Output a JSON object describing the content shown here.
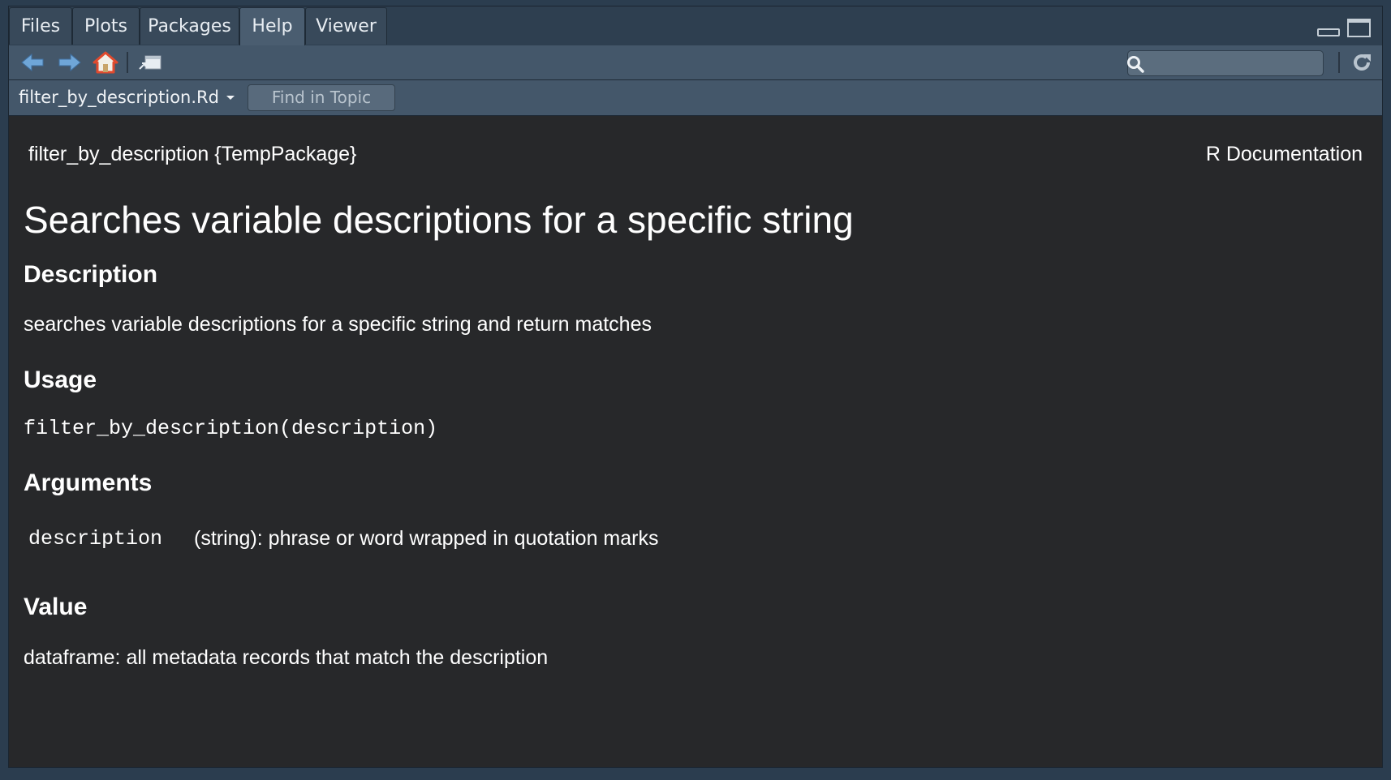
{
  "tabs": [
    {
      "label": "Files",
      "active": false
    },
    {
      "label": "Plots",
      "active": false
    },
    {
      "label": "Packages",
      "active": false
    },
    {
      "label": "Help",
      "active": true
    },
    {
      "label": "Viewer",
      "active": false
    }
  ],
  "toolbar": {
    "back_icon": "arrow-left-icon",
    "forward_icon": "arrow-right-icon",
    "home_icon": "home-icon",
    "popout_icon": "show-in-window-icon",
    "refresh_icon": "refresh-icon",
    "search_placeholder": ""
  },
  "topic_bar": {
    "topic": "filter_by_description.Rd",
    "find_label": "Find in Topic"
  },
  "doc": {
    "header_left": "filter_by_description {TempPackage}",
    "header_right": "R Documentation",
    "title": "Searches variable descriptions for a specific string",
    "sections": {
      "description_heading": "Description",
      "description_text": "searches variable descriptions for a specific string and return matches",
      "usage_heading": "Usage",
      "usage_code": "filter_by_description(description)",
      "arguments_heading": "Arguments",
      "arg_name": "description",
      "arg_desc": "(string): phrase or word wrapped in quotation marks",
      "value_heading": "Value",
      "value_text": "dataframe: all metadata records that match the description"
    }
  },
  "colors": {
    "background": "#27282a",
    "chrome": "#44576a",
    "tab_active": "#4a5d70",
    "home_icon": "#e04a2e"
  }
}
